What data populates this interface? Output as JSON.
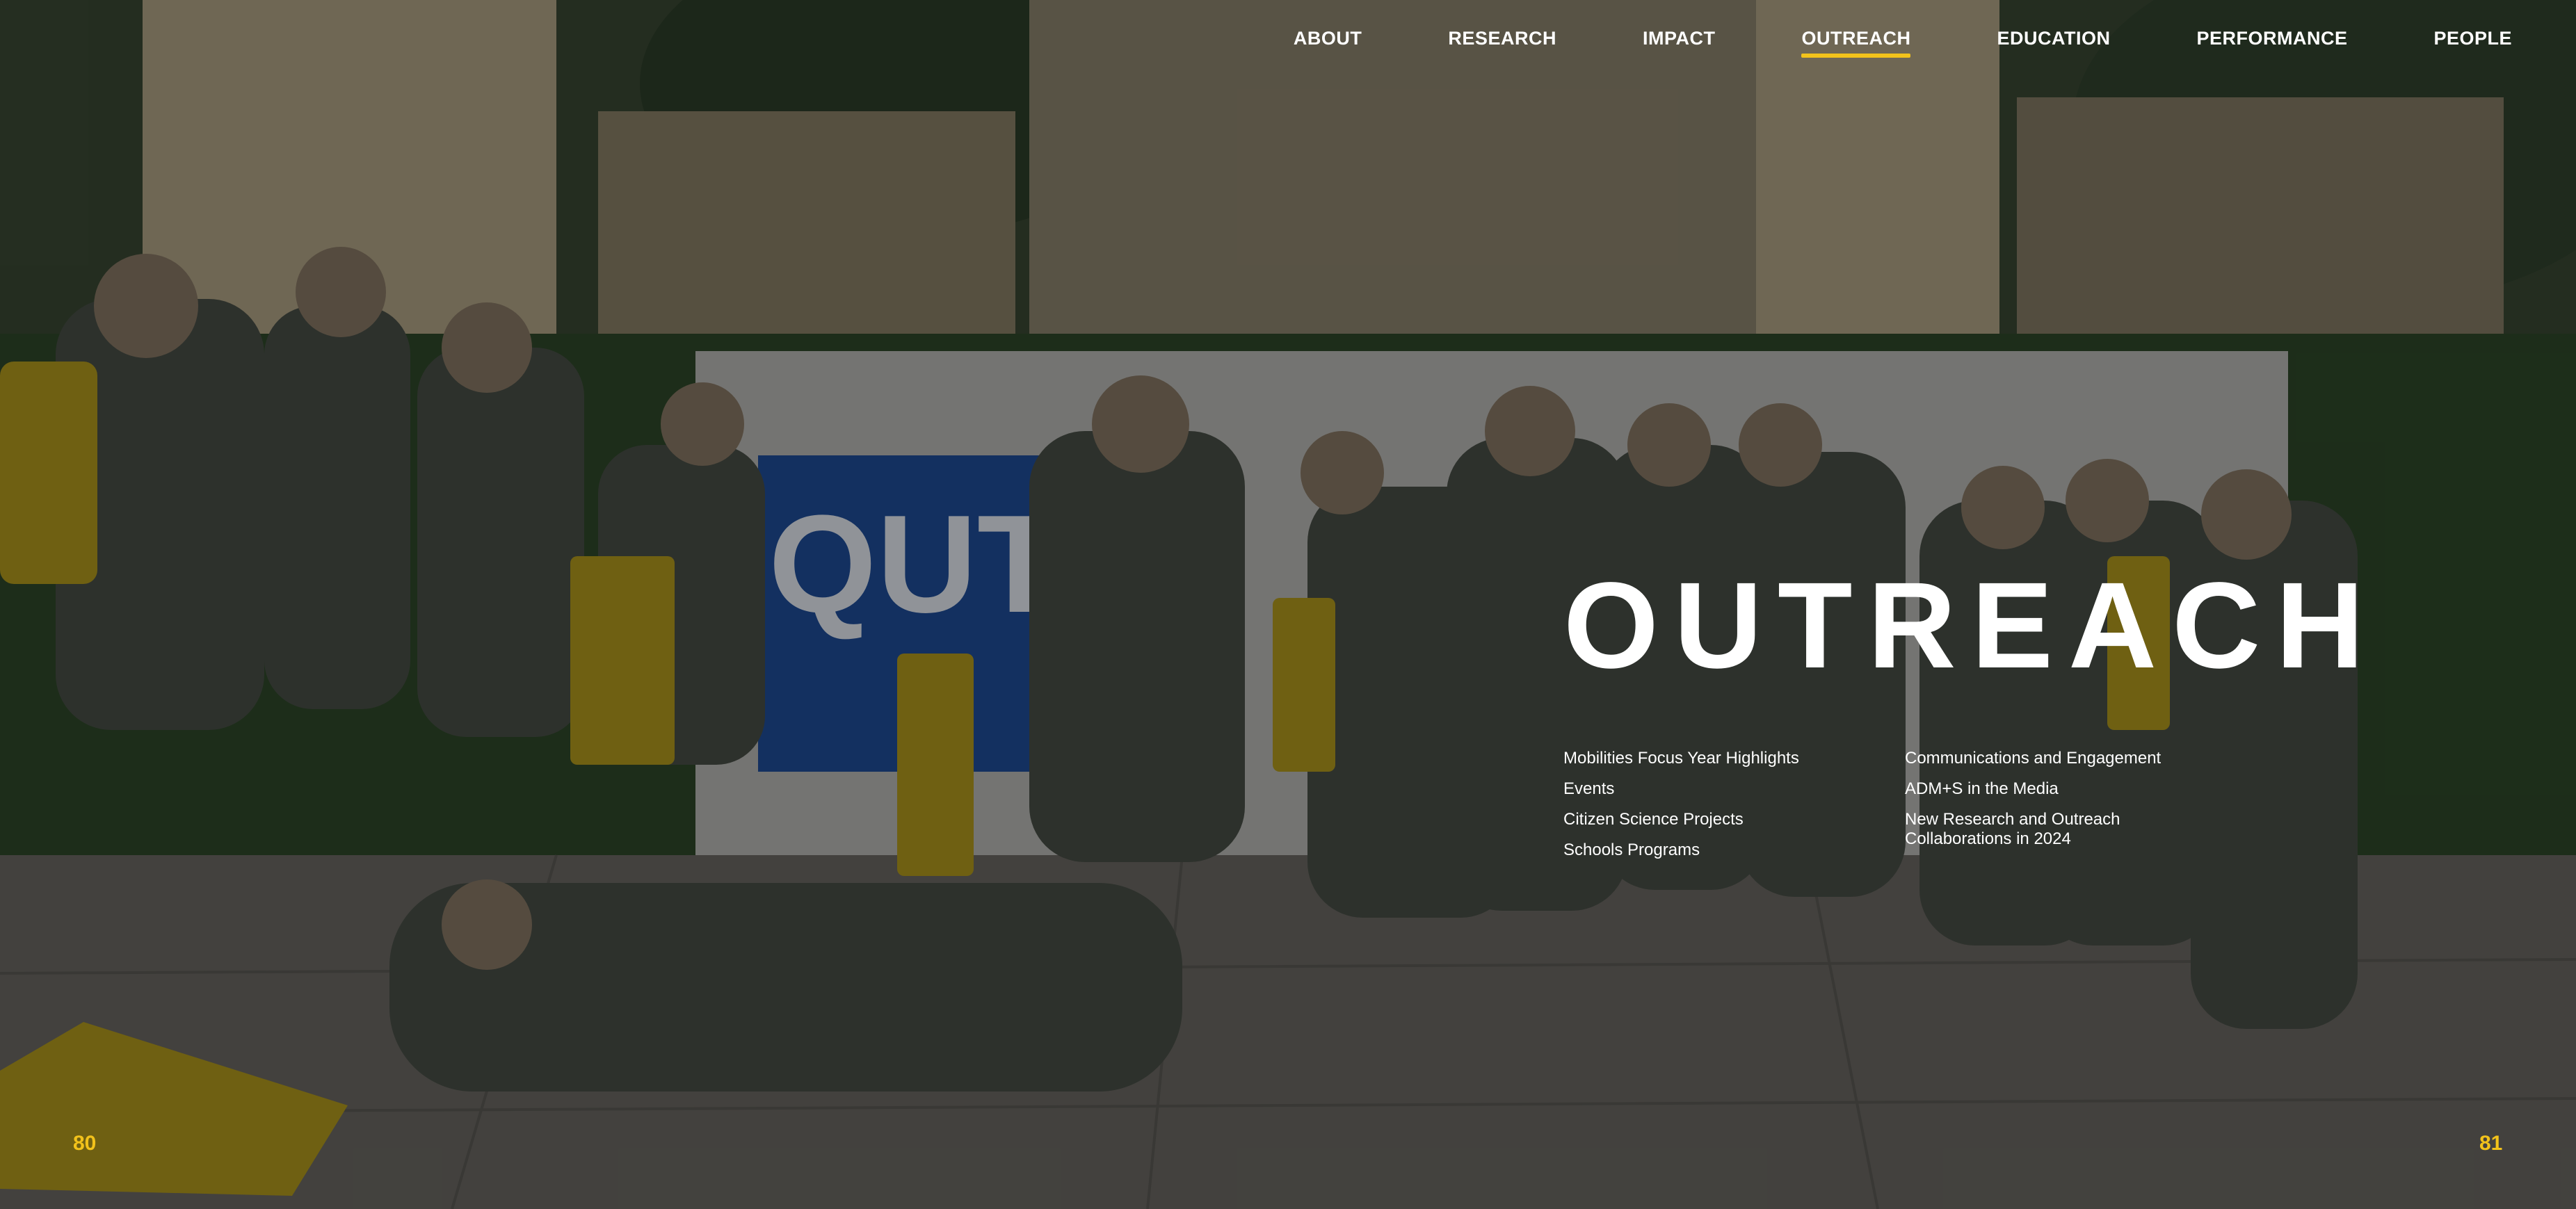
{
  "nav": {
    "items": [
      {
        "label": "ABOUT"
      },
      {
        "label": "RESEARCH"
      },
      {
        "label": "IMPACT"
      },
      {
        "label": "OUTREACH",
        "active": true
      },
      {
        "label": "EDUCATION"
      },
      {
        "label": "PERFORMANCE"
      },
      {
        "label": "PEOPLE"
      }
    ]
  },
  "hero": {
    "title": "OUTREACH"
  },
  "links": {
    "left": [
      "Mobilities Focus Year Highlights",
      "Events",
      "Citizen Science Projects",
      "Schools Programs"
    ],
    "right": [
      "Communications and Engagement",
      "ADM+S in the Media",
      "New Research and Outreach Collaborations in 2024"
    ]
  },
  "pages": {
    "left": "80",
    "right": "81"
  },
  "colors": {
    "accent": "#f2c21b",
    "text": "#ffffff",
    "overlay": "rgba(0,0,0,0.38)"
  },
  "photo": {
    "signage_text": "QUT"
  }
}
